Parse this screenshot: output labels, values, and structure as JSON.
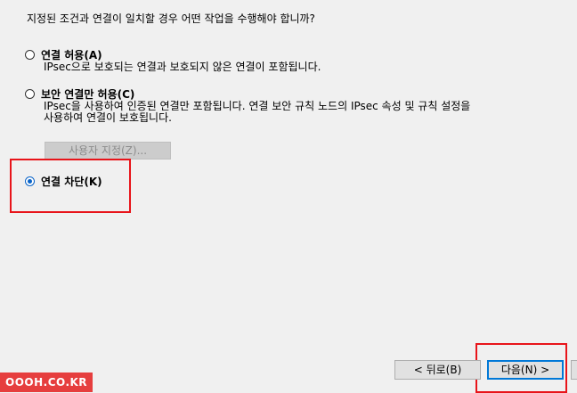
{
  "question": "지정된 조건과 연결이 일치할 경우 어떤 작업을 수행해야 합니까?",
  "options": [
    {
      "label": "연결 허용(A)",
      "selected": false,
      "description": [
        "IPsec으로 보호되는 연결과 보호되지 않은 연결이 포함됩니다."
      ]
    },
    {
      "label": "보안 연결만 허용(C)",
      "selected": false,
      "description": [
        "IPsec을 사용하여 인증된 연결만 포함됩니다. 연결 보안 규칙 노드의 IPsec 속성 및 규칙 설정을",
        "사용하여 연결이 보호됩니다."
      ]
    },
    {
      "label": "연결 차단(K)",
      "selected": true,
      "description": []
    }
  ],
  "custom_button": "사용자 지정(Z)...",
  "buttons": {
    "back": "< 뒤로(B)",
    "next": "다음(N) >"
  },
  "watermark": "OOOH.CO.KR",
  "colors": {
    "background": "#f0f0f0",
    "highlight": "#e8141a",
    "accent": "#0078d7",
    "watermark_bg": "#e63e3e"
  }
}
